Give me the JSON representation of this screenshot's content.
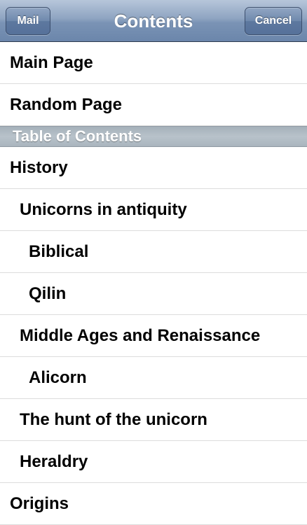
{
  "navbar": {
    "title": "Contents",
    "left_button": "Mail",
    "right_button": "Cancel"
  },
  "quick_links": [
    {
      "label": "Main Page"
    },
    {
      "label": "Random Page"
    }
  ],
  "toc": {
    "header": "Table of Contents",
    "items": [
      {
        "label": "History",
        "level": 0
      },
      {
        "label": "Unicorns in antiquity",
        "level": 1
      },
      {
        "label": "Biblical",
        "level": 2
      },
      {
        "label": "Qilin",
        "level": 2
      },
      {
        "label": "Middle Ages and Renaissance",
        "level": 1
      },
      {
        "label": "Alicorn",
        "level": 2
      },
      {
        "label": "The hunt of the unicorn",
        "level": 1
      },
      {
        "label": "Heraldry",
        "level": 1
      },
      {
        "label": "Origins",
        "level": 0
      }
    ]
  }
}
